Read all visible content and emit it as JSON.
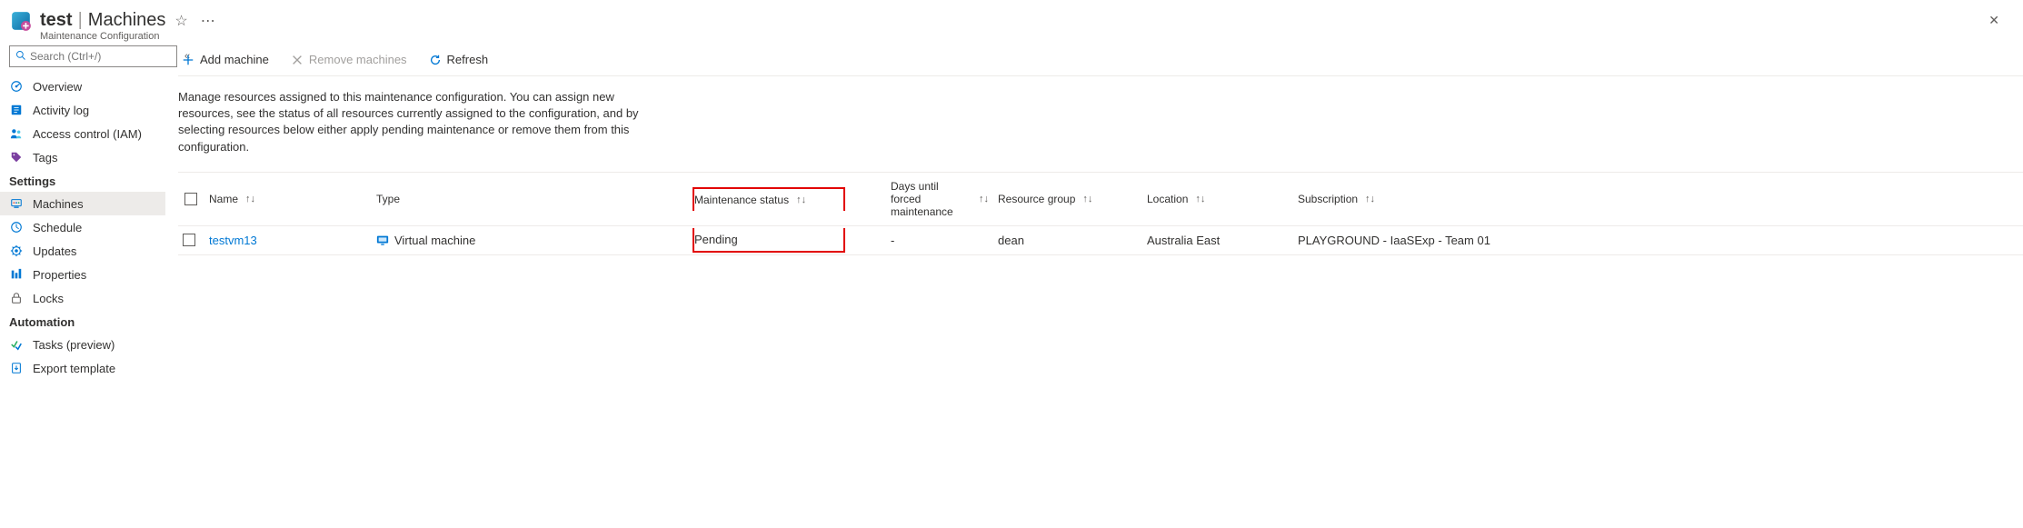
{
  "header": {
    "title_main": "test",
    "title_section": "Machines",
    "subtitle": "Maintenance Configuration"
  },
  "search": {
    "placeholder": "Search (Ctrl+/)"
  },
  "nav": {
    "items_top": [
      {
        "label": "Overview"
      },
      {
        "label": "Activity log"
      },
      {
        "label": "Access control (IAM)"
      },
      {
        "label": "Tags"
      }
    ],
    "group_settings": "Settings",
    "items_settings": [
      {
        "label": "Machines"
      },
      {
        "label": "Schedule"
      },
      {
        "label": "Updates"
      },
      {
        "label": "Properties"
      },
      {
        "label": "Locks"
      }
    ],
    "group_automation": "Automation",
    "items_automation": [
      {
        "label": "Tasks (preview)"
      },
      {
        "label": "Export template"
      }
    ]
  },
  "toolbar": {
    "add": "Add machine",
    "remove": "Remove machines",
    "refresh": "Refresh"
  },
  "description": "Manage resources assigned to this maintenance configuration. You can assign new resources, see the status of all resources currently assigned to the configuration, and by selecting resources below either apply pending maintenance or remove them from this configuration.",
  "table": {
    "headers": {
      "name": "Name",
      "type": "Type",
      "status": "Maintenance status",
      "days": "Days until forced maintenance",
      "rg": "Resource group",
      "loc": "Location",
      "sub": "Subscription"
    },
    "rows": [
      {
        "name": "testvm13",
        "type": "Virtual machine",
        "status": "Pending",
        "days": "-",
        "rg": "dean",
        "loc": "Australia East",
        "sub": "PLAYGROUND - IaaSExp - Team 01"
      }
    ]
  }
}
